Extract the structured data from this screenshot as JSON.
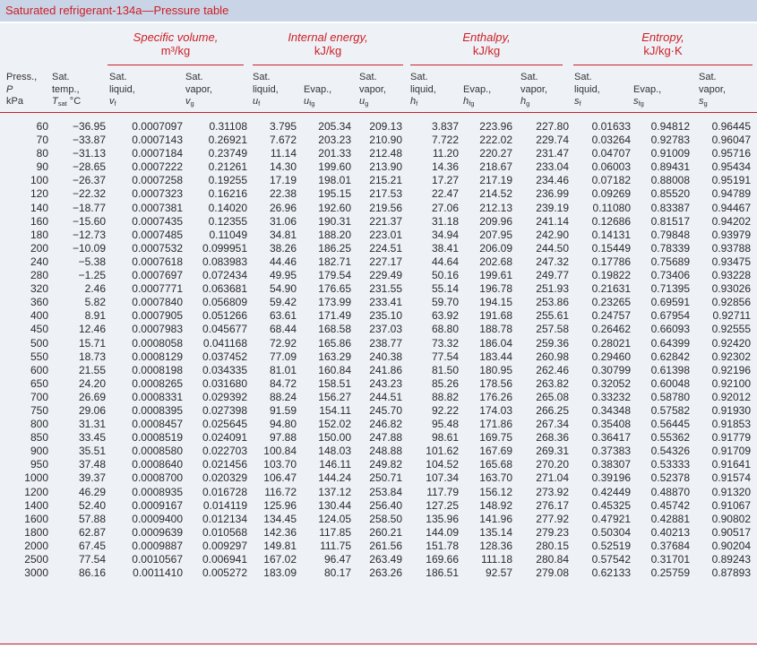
{
  "title": "Saturated refrigerant-134a—Pressure table",
  "groups": {
    "specific_volume": {
      "name": "Specific volume,",
      "unit": "m³/kg"
    },
    "internal_energy": {
      "name": "Internal energy,",
      "unit": "kJ/kg"
    },
    "enthalpy": {
      "name": "Enthalpy,",
      "unit": "kJ/kg"
    },
    "entropy": {
      "name": "Entropy,",
      "unit": "kJ/kg·K"
    }
  },
  "columns": [
    {
      "line1": "Press.,",
      "line2": "P",
      "line3": "kPa"
    },
    {
      "line1": "Sat.",
      "line2": "temp.,",
      "line3": "T",
      "sub": "sat",
      "suffix": " °C"
    },
    {
      "line1": "Sat.",
      "line2": "liquid,",
      "line3": "v",
      "sub": "f"
    },
    {
      "line1": "Sat.",
      "line2": "vapor,",
      "line3": "v",
      "sub": "g"
    },
    {
      "line1": "Sat.",
      "line2": "liquid,",
      "line3": "u",
      "sub": "f"
    },
    {
      "line1": "",
      "line2": "Evap.,",
      "line3": "u",
      "sub": "fg"
    },
    {
      "line1": "Sat.",
      "line2": "vapor,",
      "line3": "u",
      "sub": "g"
    },
    {
      "line1": "Sat.",
      "line2": "liquid,",
      "line3": "h",
      "sub": "f"
    },
    {
      "line1": "",
      "line2": "Evap.,",
      "line3": "h",
      "sub": "fg"
    },
    {
      "line1": "Sat.",
      "line2": "vapor,",
      "line3": "h",
      "sub": "g"
    },
    {
      "line1": "Sat.",
      "line2": "liquid,",
      "line3": "s",
      "sub": "f"
    },
    {
      "line1": "",
      "line2": "Evap.,",
      "line3": "s",
      "sub": "fg"
    },
    {
      "line1": "Sat.",
      "line2": "vapor,",
      "line3": "s",
      "sub": "g"
    }
  ],
  "rows": [
    [
      "60",
      "−36.95",
      "0.0007097",
      "0.31108",
      "3.795",
      "205.34",
      "209.13",
      "3.837",
      "223.96",
      "227.80",
      "0.01633",
      "0.94812",
      "0.96445"
    ],
    [
      "70",
      "−33.87",
      "0.0007143",
      "0.26921",
      "7.672",
      "203.23",
      "210.90",
      "7.722",
      "222.02",
      "229.74",
      "0.03264",
      "0.92783",
      "0.96047"
    ],
    [
      "80",
      "−31.13",
      "0.0007184",
      "0.23749",
      "11.14",
      "201.33",
      "212.48",
      "11.20",
      "220.27",
      "231.47",
      "0.04707",
      "0.91009",
      "0.95716"
    ],
    [
      "90",
      "−28.65",
      "0.0007222",
      "0.21261",
      "14.30",
      "199.60",
      "213.90",
      "14.36",
      "218.67",
      "233.04",
      "0.06003",
      "0.89431",
      "0.95434"
    ],
    [
      "100",
      "−26.37",
      "0.0007258",
      "0.19255",
      "17.19",
      "198.01",
      "215.21",
      "17.27",
      "217.19",
      "234.46",
      "0.07182",
      "0.88008",
      "0.95191"
    ],
    [
      "120",
      "−22.32",
      "0.0007323",
      "0.16216",
      "22.38",
      "195.15",
      "217.53",
      "22.47",
      "214.52",
      "236.99",
      "0.09269",
      "0.85520",
      "0.94789"
    ],
    [
      "140",
      "−18.77",
      "0.0007381",
      "0.14020",
      "26.96",
      "192.60",
      "219.56",
      "27.06",
      "212.13",
      "239.19",
      "0.11080",
      "0.83387",
      "0.94467"
    ],
    [
      "160",
      "−15.60",
      "0.0007435",
      "0.12355",
      "31.06",
      "190.31",
      "221.37",
      "31.18",
      "209.96",
      "241.14",
      "0.12686",
      "0.81517",
      "0.94202"
    ],
    [
      "180",
      "−12.73",
      "0.0007485",
      "0.11049",
      "34.81",
      "188.20",
      "223.01",
      "34.94",
      "207.95",
      "242.90",
      "0.14131",
      "0.79848",
      "0.93979"
    ],
    [
      "200",
      "−10.09",
      "0.0007532",
      "0.099951",
      "38.26",
      "186.25",
      "224.51",
      "38.41",
      "206.09",
      "244.50",
      "0.15449",
      "0.78339",
      "0.93788"
    ],
    [
      "240",
      "−5.38",
      "0.0007618",
      "0.083983",
      "44.46",
      "182.71",
      "227.17",
      "44.64",
      "202.68",
      "247.32",
      "0.17786",
      "0.75689",
      "0.93475"
    ],
    [
      "280",
      "−1.25",
      "0.0007697",
      "0.072434",
      "49.95",
      "179.54",
      "229.49",
      "50.16",
      "199.61",
      "249.77",
      "0.19822",
      "0.73406",
      "0.93228"
    ],
    [
      "320",
      "2.46",
      "0.0007771",
      "0.063681",
      "54.90",
      "176.65",
      "231.55",
      "55.14",
      "196.78",
      "251.93",
      "0.21631",
      "0.71395",
      "0.93026"
    ],
    [
      "360",
      "5.82",
      "0.0007840",
      "0.056809",
      "59.42",
      "173.99",
      "233.41",
      "59.70",
      "194.15",
      "253.86",
      "0.23265",
      "0.69591",
      "0.92856"
    ],
    [
      "400",
      "8.91",
      "0.0007905",
      "0.051266",
      "63.61",
      "171.49",
      "235.10",
      "63.92",
      "191.68",
      "255.61",
      "0.24757",
      "0.67954",
      "0.92711"
    ],
    [
      "450",
      "12.46",
      "0.0007983",
      "0.045677",
      "68.44",
      "168.58",
      "237.03",
      "68.80",
      "188.78",
      "257.58",
      "0.26462",
      "0.66093",
      "0.92555"
    ],
    [
      "500",
      "15.71",
      "0.0008058",
      "0.041168",
      "72.92",
      "165.86",
      "238.77",
      "73.32",
      "186.04",
      "259.36",
      "0.28021",
      "0.64399",
      "0.92420"
    ],
    [
      "550",
      "18.73",
      "0.0008129",
      "0.037452",
      "77.09",
      "163.29",
      "240.38",
      "77.54",
      "183.44",
      "260.98",
      "0.29460",
      "0.62842",
      "0.92302"
    ],
    [
      "600",
      "21.55",
      "0.0008198",
      "0.034335",
      "81.01",
      "160.84",
      "241.86",
      "81.50",
      "180.95",
      "262.46",
      "0.30799",
      "0.61398",
      "0.92196"
    ],
    [
      "650",
      "24.20",
      "0.0008265",
      "0.031680",
      "84.72",
      "158.51",
      "243.23",
      "85.26",
      "178.56",
      "263.82",
      "0.32052",
      "0.60048",
      "0.92100"
    ],
    [
      "700",
      "26.69",
      "0.0008331",
      "0.029392",
      "88.24",
      "156.27",
      "244.51",
      "88.82",
      "176.26",
      "265.08",
      "0.33232",
      "0.58780",
      "0.92012"
    ],
    [
      "750",
      "29.06",
      "0.0008395",
      "0.027398",
      "91.59",
      "154.11",
      "245.70",
      "92.22",
      "174.03",
      "266.25",
      "0.34348",
      "0.57582",
      "0.91930"
    ],
    [
      "800",
      "31.31",
      "0.0008457",
      "0.025645",
      "94.80",
      "152.02",
      "246.82",
      "95.48",
      "171.86",
      "267.34",
      "0.35408",
      "0.56445",
      "0.91853"
    ],
    [
      "850",
      "33.45",
      "0.0008519",
      "0.024091",
      "97.88",
      "150.00",
      "247.88",
      "98.61",
      "169.75",
      "268.36",
      "0.36417",
      "0.55362",
      "0.91779"
    ],
    [
      "900",
      "35.51",
      "0.0008580",
      "0.022703",
      "100.84",
      "148.03",
      "248.88",
      "101.62",
      "167.69",
      "269.31",
      "0.37383",
      "0.54326",
      "0.91709"
    ],
    [
      "950",
      "37.48",
      "0.0008640",
      "0.021456",
      "103.70",
      "146.11",
      "249.82",
      "104.52",
      "165.68",
      "270.20",
      "0.38307",
      "0.53333",
      "0.91641"
    ],
    [
      "1000",
      "39.37",
      "0.0008700",
      "0.020329",
      "106.47",
      "144.24",
      "250.71",
      "107.34",
      "163.70",
      "271.04",
      "0.39196",
      "0.52378",
      "0.91574"
    ],
    [
      "1200",
      "46.29",
      "0.0008935",
      "0.016728",
      "116.72",
      "137.12",
      "253.84",
      "117.79",
      "156.12",
      "273.92",
      "0.42449",
      "0.48870",
      "0.91320"
    ],
    [
      "1400",
      "52.40",
      "0.0009167",
      "0.014119",
      "125.96",
      "130.44",
      "256.40",
      "127.25",
      "148.92",
      "276.17",
      "0.45325",
      "0.45742",
      "0.91067"
    ],
    [
      "1600",
      "57.88",
      "0.0009400",
      "0.012134",
      "134.45",
      "124.05",
      "258.50",
      "135.96",
      "141.96",
      "277.92",
      "0.47921",
      "0.42881",
      "0.90802"
    ],
    [
      "1800",
      "62.87",
      "0.0009639",
      "0.010568",
      "142.36",
      "117.85",
      "260.21",
      "144.09",
      "135.14",
      "279.23",
      "0.50304",
      "0.40213",
      "0.90517"
    ],
    [
      "2000",
      "67.45",
      "0.0009887",
      "0.009297",
      "149.81",
      "111.75",
      "261.56",
      "151.78",
      "128.36",
      "280.15",
      "0.52519",
      "0.37684",
      "0.90204"
    ],
    [
      "2500",
      "77.54",
      "0.0010567",
      "0.006941",
      "167.02",
      "96.47",
      "263.49",
      "169.66",
      "111.18",
      "280.84",
      "0.57542",
      "0.31701",
      "0.89243"
    ],
    [
      "3000",
      "86.16",
      "0.0011410",
      "0.005272",
      "183.09",
      "80.17",
      "263.26",
      "186.51",
      "92.57",
      "279.08",
      "0.62133",
      "0.25759",
      "0.87893"
    ]
  ]
}
